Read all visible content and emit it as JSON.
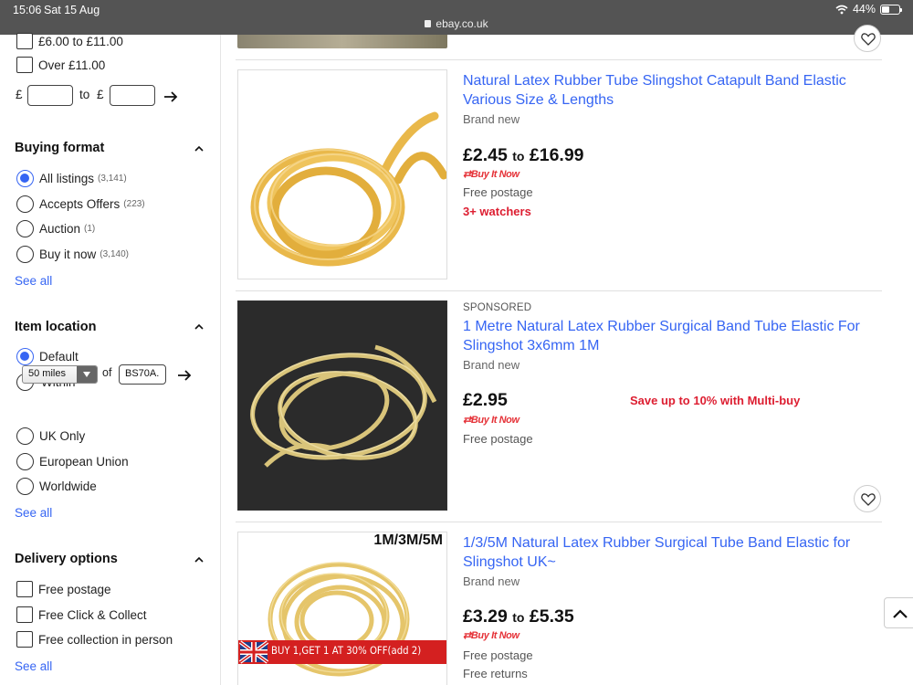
{
  "status_bar": {
    "time": "15:06",
    "date": "Sat 15 Aug",
    "url": "ebay.co.uk",
    "battery": "44%",
    "battery_level": 0.44
  },
  "sidebar": {
    "price": {
      "options": [
        {
          "label": "£6.00 to £11.00",
          "checked": false
        },
        {
          "label": "Over £11.00",
          "checked": false
        }
      ],
      "currency_symbol": "£",
      "to_label": "to",
      "min_value": "",
      "max_value": ""
    },
    "buying_format": {
      "title": "Buying format",
      "options": [
        {
          "label": "All listings",
          "count": "(3,141)",
          "selected": true
        },
        {
          "label": "Accepts Offers",
          "count": "(223)",
          "selected": false
        },
        {
          "label": "Auction",
          "count": "(1)",
          "selected": false
        },
        {
          "label": "Buy it now",
          "count": "(3,140)",
          "selected": false
        }
      ],
      "see_all": "See all"
    },
    "item_location": {
      "title": "Item location",
      "default_label": "Default",
      "within_label": "Within",
      "distance": "50 miles",
      "of_label": "of",
      "postcode": "BS70A.",
      "options": [
        "UK Only",
        "European Union",
        "Worldwide"
      ],
      "see_all": "See all"
    },
    "delivery": {
      "title": "Delivery options",
      "options": [
        "Free postage",
        "Free Click & Collect",
        "Free collection in person"
      ],
      "see_all": "See all"
    }
  },
  "listings": [
    {
      "title": "Natural Latex Rubber Tube Slingshot Catapult Band Elastic Various Size & Lengths",
      "condition": "Brand new",
      "price_from": "£2.45",
      "price_to_word": "to",
      "price_to": "£16.99",
      "format": "Buy It Now",
      "shipping": "Free postage",
      "watchers": "3+ watchers"
    },
    {
      "sponsored": "SPONSORED",
      "title": "1 Metre Natural Latex Rubber Surgical Band Tube Elastic For Slingshot 3x6mm 1M",
      "condition": "Brand new",
      "price": "£2.95",
      "format": "Buy It Now",
      "shipping": "Free postage",
      "promo": "Save up to 10% with Multi-buy"
    },
    {
      "title": "1/3/5M Natural Latex Rubber Surgical Tube Band Elastic for Slingshot UK~",
      "condition": "Brand new",
      "price_from": "£3.29",
      "price_to_word": "to",
      "price_to": "£5.35",
      "format": "Buy It Now",
      "shipping": "Free postage",
      "returns": "Free returns",
      "image_badge": "1M/3M/5M",
      "image_banner": "BUY 1,GET 1 AT 30% OFF(add 2)"
    }
  ],
  "colors": {
    "link": "#3665f3",
    "alert": "#dd1e31",
    "bin_red": "#e53238",
    "tube_yellow": "#e9b84a"
  }
}
